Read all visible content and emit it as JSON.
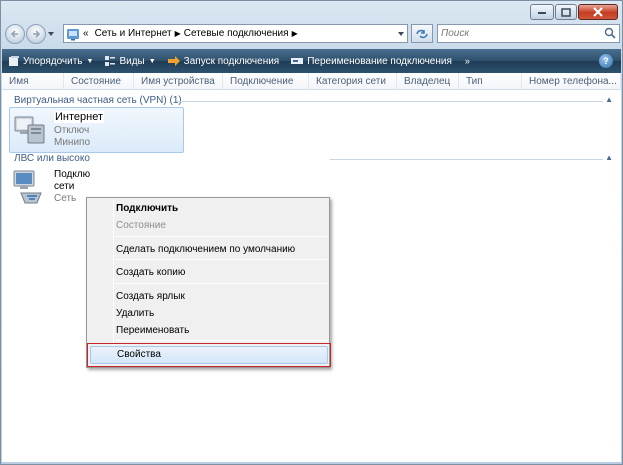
{
  "breadcrumb": {
    "prefix": "«",
    "items": [
      "Сеть и Интернет",
      "Сетевые подключения"
    ]
  },
  "search": {
    "placeholder": "Поиск"
  },
  "toolbar": {
    "organize": "Упорядочить",
    "views": "Виды",
    "start_connection": "Запуск подключения",
    "rename_connection": "Переименование подключения",
    "more": "»",
    "help": "?"
  },
  "columns": [
    "Имя",
    "Состояние",
    "Имя устройства",
    "Подключение",
    "Категория сети",
    "Владелец",
    "Тип",
    "Номер телефона..."
  ],
  "groups": {
    "vpn": {
      "title": "Виртуальная частная сеть (VPN) (1)",
      "item": {
        "name": "Интернет",
        "status": "Отключ",
        "device": "Минипо"
      }
    },
    "lan": {
      "title": "ЛВС или высоко",
      "item": {
        "name_line1": "Подклю",
        "name_line2": "сети",
        "status": "Сеть"
      }
    }
  },
  "context_menu": {
    "connect": "Подключить",
    "status": "Состояние",
    "set_default": "Сделать подключением по умолчанию",
    "create_copy": "Создать копию",
    "create_shortcut": "Создать ярлык",
    "delete": "Удалить",
    "rename": "Переименовать",
    "properties": "Свойства"
  },
  "colors": {
    "command_bar": "#2d4f6c",
    "highlight_border": "#c4262b",
    "group_title": "#3e5c85"
  }
}
